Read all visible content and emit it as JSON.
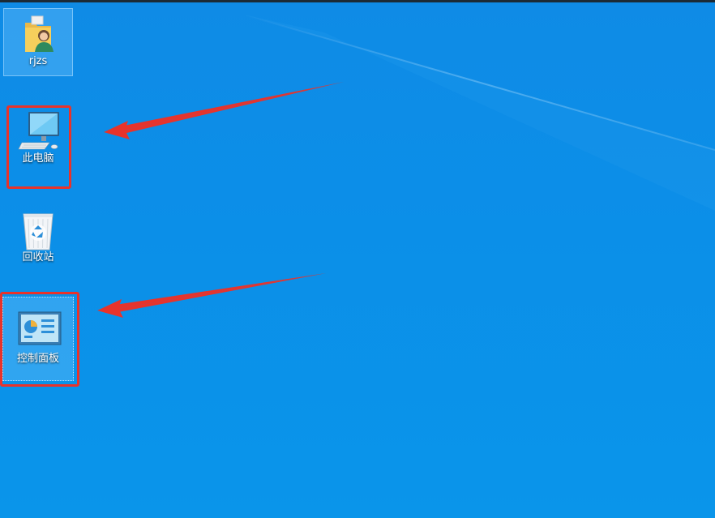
{
  "desktop": {
    "icons": [
      {
        "label": "rjzs",
        "icon": "user-folder-icon"
      },
      {
        "label": "此电脑",
        "icon": "computer-icon"
      },
      {
        "label": "回收站",
        "icon": "recycle-bin-icon"
      },
      {
        "label": "控制面板",
        "icon": "control-panel-icon"
      }
    ]
  },
  "colors": {
    "wallpaper": "#0b8fe8",
    "highlight": "#e8332b"
  }
}
